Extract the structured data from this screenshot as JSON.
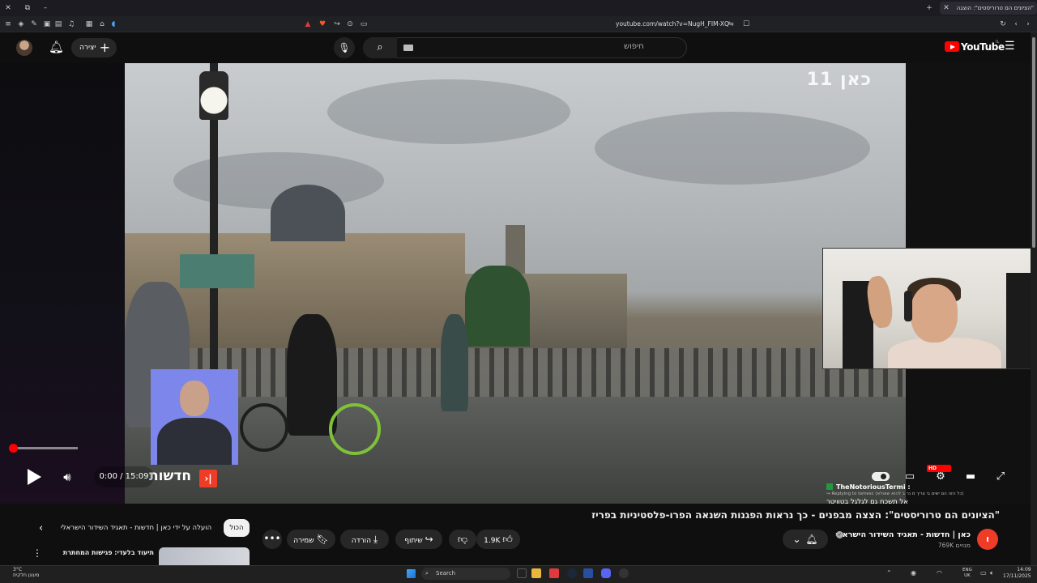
{
  "browser": {
    "tab_title": "\"הציונים הם טרוריסטים\": הוצגה",
    "url": "youtube.com/watch?v=NugH_FIM-XQ"
  },
  "header": {
    "create_label": "יצירה",
    "search_placeholder": "חיפוש",
    "logo_text": "YouTube",
    "country_code": "IL"
  },
  "player": {
    "watermark": "כאן 11",
    "news_logo_text": "חדשות",
    "current_time": "0:00",
    "duration": "15:09",
    "time_display": "0:00 / 15:09",
    "progress_fraction": 0.0,
    "hd_badge": "HD"
  },
  "chat": {
    "username": "TheNotoriousTermi :",
    "reply_text": "↪ Replying to lomesc (כל הזה הם ישים בי צריך מ נר ב להוא שאולא)",
    "message": "אל תשכח גם לגלגל בטוויטר"
  },
  "video": {
    "title": "\"הציונים הם טרוריסטים\": הצצה מבפנים - כך נראות הפגנות השנאה הפרו-פלסטיניות בפריז",
    "channel_name": "כאן | חדשות - תאגיד השידור הישראלי",
    "subscribers": "769K מנויים",
    "channel_avatar_glyph": "ו"
  },
  "actions": {
    "likes": "1.9K",
    "share_label": "שיתוף",
    "download_label": "הורדה",
    "save_label": "שמירה"
  },
  "chips": {
    "all_label": "הכול",
    "uploaded_by_label": "הועלה על ידי כאן | חדשות - תאגיד השידור הישראלי"
  },
  "related": {
    "title": "תיעוד בלעדי: פגישות המחתרת"
  },
  "taskbar": {
    "weather_temp": "3°C",
    "weather_desc": "מעונן חלקית",
    "search_placeholder": "Search",
    "lang_top": "ENG",
    "lang_bottom": "UK",
    "time": "14:09",
    "date": "17/11/2025"
  },
  "colors": {
    "accent_red": "#ff0000",
    "kan_red": "#ef3c26",
    "background": "#0f0f0f"
  }
}
